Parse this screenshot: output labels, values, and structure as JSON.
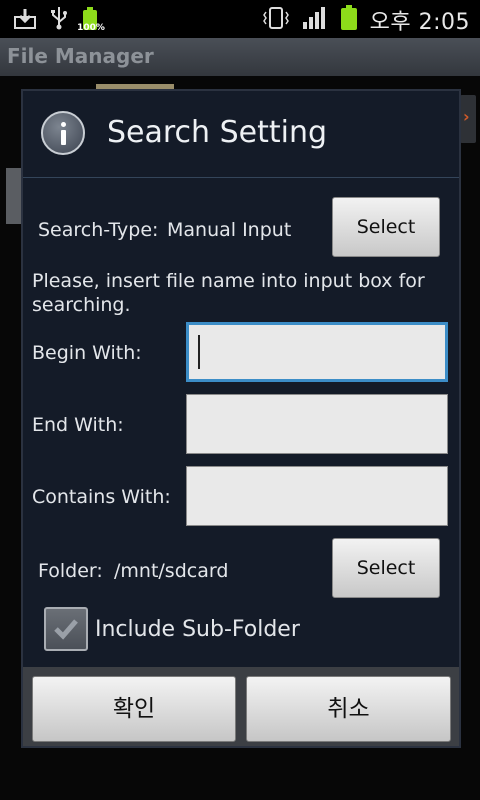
{
  "status": {
    "battery_percent": "100%",
    "time": "오후 2:05"
  },
  "app": {
    "title": "File Manager"
  },
  "dialog": {
    "title": "Search Setting",
    "search_type_label": "Search-Type:",
    "search_type_value": "Manual Input",
    "select_label": "Select",
    "instruction": "Please, insert file name into input box for searching.",
    "begin_label": "Begin With:",
    "end_label": "End With:",
    "contains_label": "Contains With:",
    "folder_label": "Folder:",
    "folder_value": "/mnt/sdcard",
    "folder_select_label": "Select",
    "include_subfolder_label": "Include Sub-Folder",
    "include_subfolder_checked": true,
    "ok_label": "확인",
    "cancel_label": "취소"
  },
  "colors": {
    "dialog_bg": "#141b28",
    "focus_border": "#3c8dc7",
    "battery_green": "#8ddc1a"
  }
}
